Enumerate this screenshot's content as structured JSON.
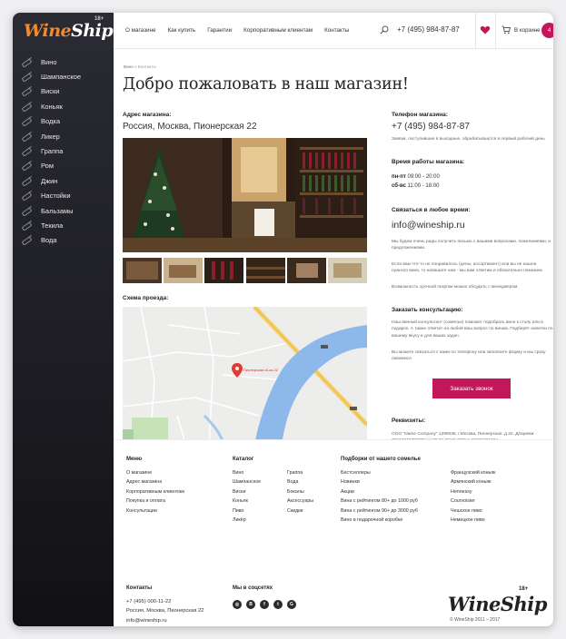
{
  "brand": {
    "wine": "Wine",
    "ship": "Ship",
    "age": "18+"
  },
  "sidebar": {
    "items": [
      {
        "label": "Вино"
      },
      {
        "label": "Шампанское"
      },
      {
        "label": "Виски"
      },
      {
        "label": "Коньяк"
      },
      {
        "label": "Водка"
      },
      {
        "label": "Ликер"
      },
      {
        "label": "Граппа"
      },
      {
        "label": "Ром"
      },
      {
        "label": "Джин"
      },
      {
        "label": "Настойки"
      },
      {
        "label": "Бальзамы"
      },
      {
        "label": "Текила"
      },
      {
        "label": "Вода"
      }
    ]
  },
  "header": {
    "nav": [
      "О магазине",
      "Как купить",
      "Гарантии",
      "Корпоративным клиентам",
      "Контакты"
    ],
    "phone": "+7 (495) 984-87-87",
    "cart_label": "В корзине",
    "cart_count": "4"
  },
  "breadcrumbs": {
    "home": "Вино",
    "sep": "»",
    "current": "Контакты"
  },
  "page_title": "Добро пожаловать в наш магазин!",
  "store": {
    "address_label": "Адрес магазина:",
    "address": "Россия, Москва, Пионерская 22",
    "map_label": "Схема проезда:",
    "map_pin_label": "Пионерская Ш-ка 22"
  },
  "contacts": {
    "phone_label": "Телефон магазина:",
    "phone": "+7 (495) 984-87-87",
    "phone_note": "Заявки, поступившие в выходные, обрабатываются в первый рабочий день",
    "hours_label": "Время работы магазина:",
    "hours_weekdays_key": "пн-пт",
    "hours_weekdays": "09:00 - 20:00",
    "hours_weekend_key": "сб-вс",
    "hours_weekend": "11:00 - 18:00",
    "contact_label": "Связаться в любое время:",
    "email": "info@wineship.ru",
    "contact_text1": "Мы будем очень рады получить письмо с вашими вопросами, пожеланиями, и предложениями.",
    "contact_text2": "Если вам что-то не понравилось (цены, ассортимент) или вы не нашли нужного вина, то напишите нам - мы вам ответим и обязательно поможем.",
    "contact_text3": "Возможность срочной покупки можно обсудить с менеджером.",
    "consult_label": "Заказать консультацию:",
    "consult_text1": "Наш винный консультант (сомелье) поможет подобрать вино к столу или в подарок. А также ответит на любой ваш вопрос по винам. Подберёт напитки по вашему вкусу и для ваших задач.",
    "consult_text2": "Вы можете связаться с нами по телефону или заполните форму и мы сразу свяжемся",
    "call_button": "Заказать звонок",
    "requisites_label": "Реквизиты:",
    "requisites": "ООО \"Name Company\" 1299036, г.Москва, Пионерская ,д.22, Д/нцияки: 785748457ПОПУ от 08.06.2016) ОГРН: 98325298484"
  },
  "footer": {
    "menu_title": "Меню",
    "menu": [
      "О магазине",
      "Адрес магазина",
      "Корпоративным клиентам",
      "Покупка и оплата",
      "Консультации"
    ],
    "catalog_title": "Каталог",
    "catalog_col1": [
      "Вино",
      "Шампанское",
      "Виски",
      "Коньяк",
      "Пиво",
      "Ликёр"
    ],
    "catalog_col2": [
      "Граппа",
      "Вода",
      "Бокалы",
      "Аксессуары",
      "Скидки"
    ],
    "picks_title": "Подборки от нашего сомелье",
    "picks_col1": [
      "Бестселлеры",
      "Новинки",
      "Акции",
      "Вина с рейтингом 80+ до 1000 руб",
      "Вина с рейтингом 90+ до 3000 руб",
      "Вино в подарочной коробке"
    ],
    "picks_col2": [
      "Французский коньяк",
      "Армянский коньяк",
      "Hennessy",
      "Courvoisier",
      "Чешское пиво",
      "Немецкое пиво"
    ],
    "contacts_title": "Контакты",
    "contacts": [
      "+7 (495) 000-11-22",
      "Россия, Москва, Пионерская 22",
      "info@wineship.ru"
    ],
    "social_title": "Мы в соцсетях",
    "social": [
      "instagram-icon",
      "vk-icon",
      "facebook-icon",
      "twitter-icon",
      "google-plus-icon"
    ],
    "copyright": "© WineShip 2011 – 2017"
  },
  "colors": {
    "accent": "#c2185b",
    "brand_orange": "#f28b2c",
    "sidebar_bg": "#1c1c22"
  }
}
